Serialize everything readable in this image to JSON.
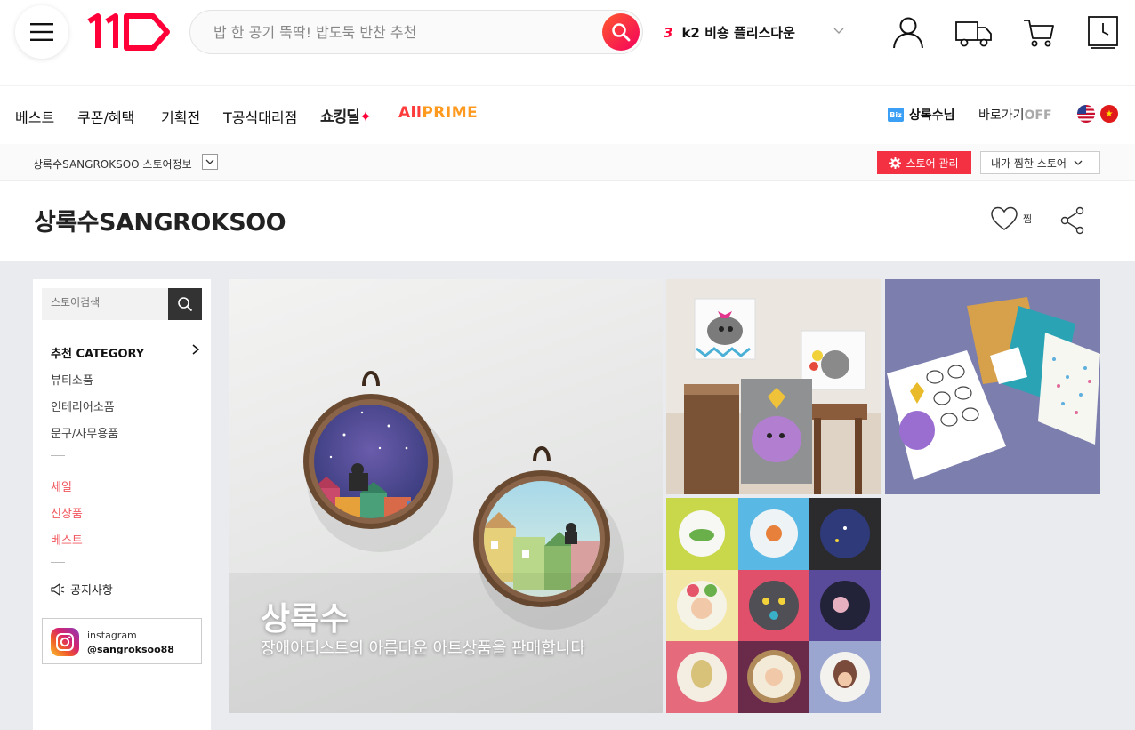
{
  "header": {
    "search_placeholder": "밥 한 공기 뚝딱! 밥도둑 반찬 추천",
    "rank_number": "3",
    "rank_keyword": "k2 비숑 플리스다운",
    "brand_color": "#ff0038"
  },
  "nav": {
    "items": [
      "베스트",
      "쿠폰/혜택",
      "기획전",
      "T공식대리점"
    ],
    "shocking_deal": "쇼킹딜",
    "all_prime_prefix": "All",
    "all_prime_suffix": "PRIME",
    "biz_badge": "Biz",
    "user_name": "상록수님",
    "shortcut_label": "바로가기",
    "shortcut_state": "OFF"
  },
  "store_bar": {
    "store_info": "상록수SANGROKSOO 스토어정보",
    "manage_label": "스토어 관리",
    "favorite_stores": "내가 찜한 스토어"
  },
  "store": {
    "title": "상록수SANGROKSOO",
    "zzim_label": "찜"
  },
  "sidebar": {
    "search_placeholder": "스토어검색",
    "category_title": "추천 CATEGORY",
    "categories": [
      "뷰티소품",
      "인테리어소품",
      "문구/사무용품"
    ],
    "special": [
      "세일",
      "신상품",
      "베스트"
    ],
    "notice": "공지사항",
    "instagram_label": "instagram",
    "instagram_handle": "@sangroksoo88"
  },
  "banner": {
    "title": "상록수",
    "subtitle": "장애아티스트의 아름다운 아트상품을 판매합니다"
  }
}
